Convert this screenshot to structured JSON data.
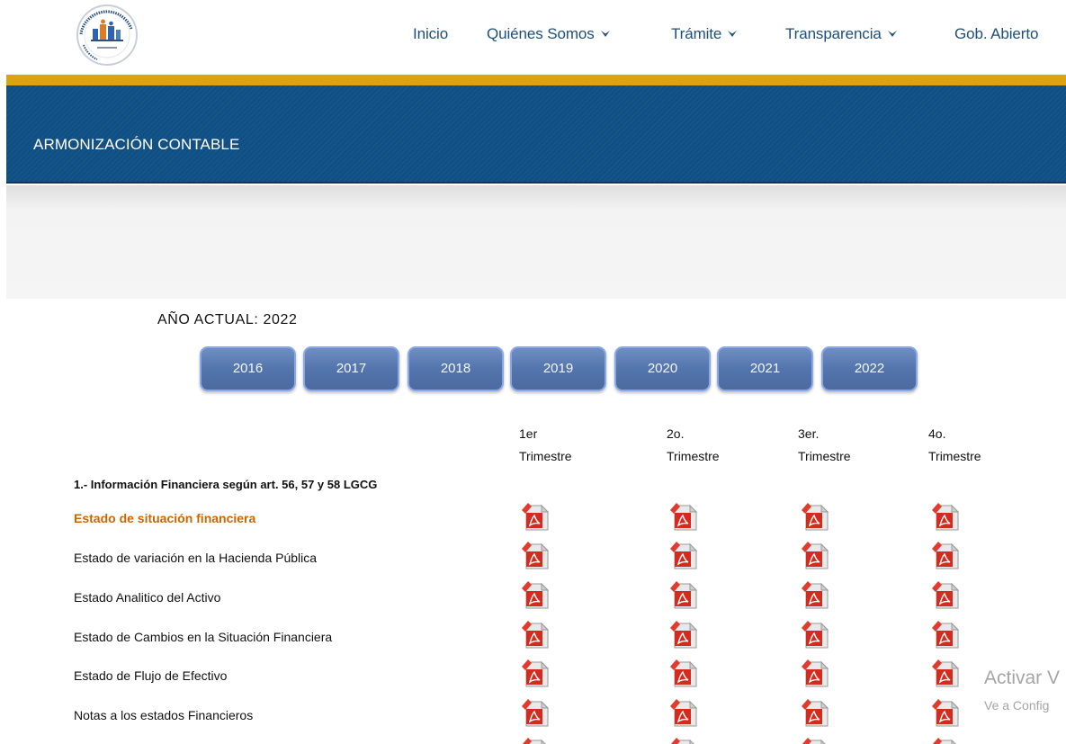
{
  "header": {
    "logo_icon": "agency-seal-logo",
    "nav": [
      {
        "label": "Inicio",
        "dropdown": false
      },
      {
        "label": "Quiénes Somos",
        "dropdown": true
      },
      {
        "label": "Trámite",
        "dropdown": true
      },
      {
        "label": "Transparencia",
        "dropdown": true
      },
      {
        "label": "Gob. Abierto",
        "dropdown": false
      }
    ]
  },
  "colors": {
    "nav_text": "#1d4f7a",
    "gold_strip": "#d9a312",
    "banner_bg": "#0f4f84",
    "year_button": "#5375ad",
    "active_row": "#cc6600",
    "pdf_icon": "#d52b1e"
  },
  "banner": {
    "title": "ARMONIZACIÓN CONTABLE"
  },
  "year_selector": {
    "current_label": "AÑO ACTUAL: 2022",
    "years": [
      "2016",
      "2017",
      "2018",
      "2019",
      "2020",
      "2021",
      "2022"
    ]
  },
  "table": {
    "columns": [
      {
        "line1": "1er",
        "line2": "Trimestre"
      },
      {
        "line1": "2o.",
        "line2": "Trimestre"
      },
      {
        "line1": "3er.",
        "line2": "Trimestre"
      },
      {
        "line1": "4o.",
        "line2": "Trimestre"
      }
    ],
    "section_title": "1.- Información Financiera según art. 56, 57 y 58 LGCG",
    "rows": [
      {
        "label": "Estado de situación financiera",
        "active": true
      },
      {
        "label": "Estado de variación en la Hacienda Pública",
        "active": false
      },
      {
        "label": "Estado Analitico del Activo",
        "active": false
      },
      {
        "label": "Estado de Cambios en la Situación Financiera",
        "active": false
      },
      {
        "label": "Estado de Flujo de Efectivo",
        "active": false
      },
      {
        "label": "Notas a los estados Financieros",
        "active": false
      }
    ],
    "cell_icon": "pdf-file-icon"
  },
  "watermark": {
    "line1": "Activar V",
    "line2": "Ve a Config"
  }
}
